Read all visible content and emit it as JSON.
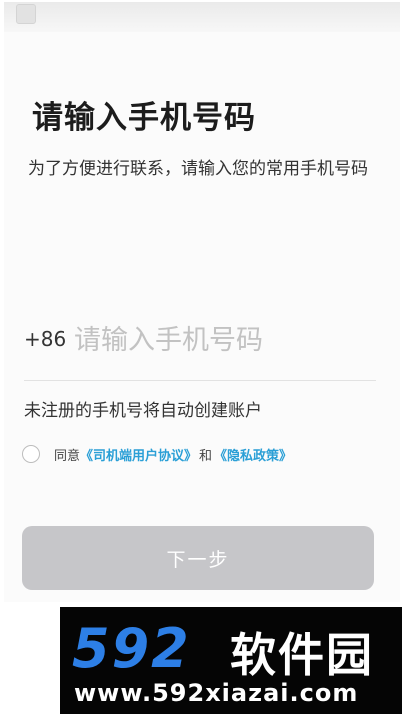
{
  "header": {
    "title": "请输入手机号码",
    "subtitle": "为了方便进行联系，请输入您的常用手机号码"
  },
  "phone": {
    "country_code": "+86",
    "placeholder": "请输入手机号码",
    "value": ""
  },
  "hint": "未注册的手机号将自动创建账户",
  "agreement": {
    "prefix": "同意",
    "user_agreement": "《司机端用户协议》",
    "and": "和",
    "privacy_policy": "《隐私政策》",
    "checked": false
  },
  "next_button": "下一步",
  "watermark": {
    "logo_number": "592",
    "logo_text": "软件园",
    "url": "www.592xiazai.com"
  },
  "colors": {
    "link": "#2a9fd6",
    "button_disabled": "#c6c6c9",
    "watermark_blue": "#2d7fe6"
  }
}
